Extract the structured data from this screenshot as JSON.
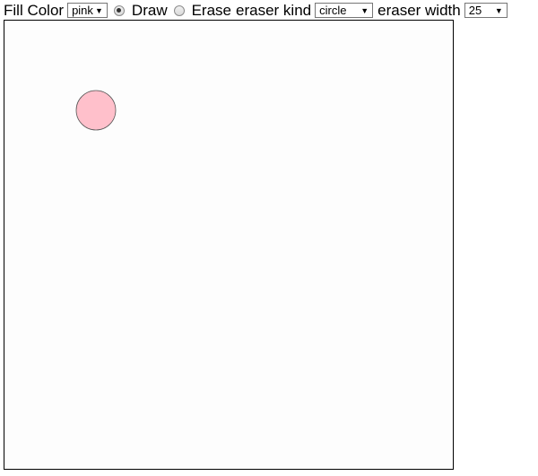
{
  "toolbar": {
    "fill_color_label": "Fill Color",
    "fill_color_value": "pink",
    "draw_label": "Draw",
    "draw_selected": true,
    "erase_label": "Erase",
    "erase_selected": false,
    "eraser_kind_label": "eraser kind",
    "eraser_kind_value": "circle",
    "eraser_width_label": "eraser width",
    "eraser_width_value": "25",
    "dropdown_arrow_icon": "triangle-down-icon"
  },
  "canvas": {
    "background_color": "#fdfdfd",
    "shapes": [
      {
        "kind": "circle",
        "fill": "#ffc0cb",
        "stroke": "#555555"
      }
    ]
  }
}
